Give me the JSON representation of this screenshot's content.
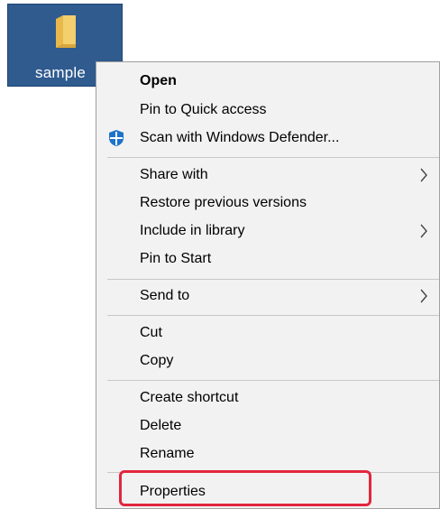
{
  "desktop": {
    "folder_label": "sample",
    "folder_icon": "folder-icon",
    "selection_color": "#2f5b8f"
  },
  "menu": {
    "groups": [
      [
        {
          "label": "Open",
          "bold": true
        },
        {
          "label": "Pin to Quick access"
        },
        {
          "label": "Scan with Windows Defender...",
          "icon": "windows-defender-icon"
        }
      ],
      [
        {
          "label": "Share with",
          "submenu": true
        },
        {
          "label": "Restore previous versions"
        },
        {
          "label": "Include in library",
          "submenu": true
        },
        {
          "label": "Pin to Start"
        }
      ],
      [
        {
          "label": "Send to",
          "submenu": true
        }
      ],
      [
        {
          "label": "Cut"
        },
        {
          "label": "Copy"
        }
      ],
      [
        {
          "label": "Create shortcut"
        },
        {
          "label": "Delete"
        },
        {
          "label": "Rename"
        }
      ],
      [
        {
          "label": "Properties",
          "highlighted": true
        }
      ]
    ]
  },
  "highlight_color": "#e3263f"
}
